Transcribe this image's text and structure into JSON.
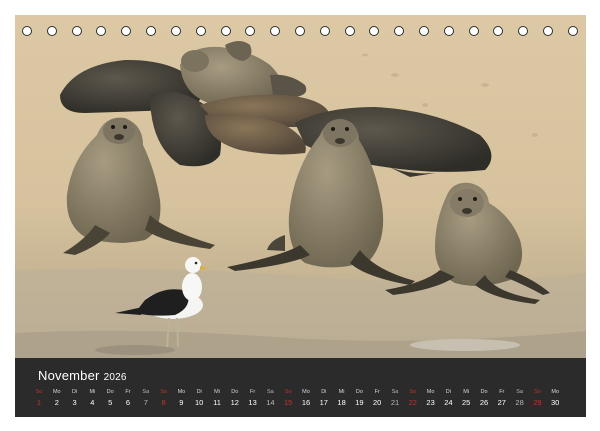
{
  "calendar": {
    "month": "November",
    "year": "2026",
    "days": [
      {
        "wd": "So",
        "d": "1",
        "kind": "sun"
      },
      {
        "wd": "Mo",
        "d": "2",
        "kind": "week"
      },
      {
        "wd": "Di",
        "d": "3",
        "kind": "week"
      },
      {
        "wd": "Mi",
        "d": "4",
        "kind": "week"
      },
      {
        "wd": "Do",
        "d": "5",
        "kind": "week"
      },
      {
        "wd": "Fr",
        "d": "6",
        "kind": "week"
      },
      {
        "wd": "Sa",
        "d": "7",
        "kind": "sat"
      },
      {
        "wd": "So",
        "d": "8",
        "kind": "sun"
      },
      {
        "wd": "Mo",
        "d": "9",
        "kind": "week"
      },
      {
        "wd": "Di",
        "d": "10",
        "kind": "week"
      },
      {
        "wd": "Mi",
        "d": "11",
        "kind": "week"
      },
      {
        "wd": "Do",
        "d": "12",
        "kind": "week"
      },
      {
        "wd": "Fr",
        "d": "13",
        "kind": "week"
      },
      {
        "wd": "Sa",
        "d": "14",
        "kind": "sat"
      },
      {
        "wd": "So",
        "d": "15",
        "kind": "sun"
      },
      {
        "wd": "Mo",
        "d": "16",
        "kind": "week"
      },
      {
        "wd": "Di",
        "d": "17",
        "kind": "week"
      },
      {
        "wd": "Mi",
        "d": "18",
        "kind": "week"
      },
      {
        "wd": "Do",
        "d": "19",
        "kind": "week"
      },
      {
        "wd": "Fr",
        "d": "20",
        "kind": "week"
      },
      {
        "wd": "Sa",
        "d": "21",
        "kind": "sat"
      },
      {
        "wd": "So",
        "d": "22",
        "kind": "sun"
      },
      {
        "wd": "Mo",
        "d": "23",
        "kind": "week"
      },
      {
        "wd": "Di",
        "d": "24",
        "kind": "week"
      },
      {
        "wd": "Mi",
        "d": "25",
        "kind": "week"
      },
      {
        "wd": "Do",
        "d": "26",
        "kind": "week"
      },
      {
        "wd": "Fr",
        "d": "27",
        "kind": "week"
      },
      {
        "wd": "Sa",
        "d": "28",
        "kind": "sat"
      },
      {
        "wd": "So",
        "d": "29",
        "kind": "sun"
      },
      {
        "wd": "Mo",
        "d": "30",
        "kind": "week"
      }
    ]
  },
  "binding": {
    "hole_count": 23
  },
  "colors": {
    "sand": "#d8c49f",
    "wet_sand": "#bfae8e",
    "bar": "#2b2b2b",
    "sunday": "#c0342b"
  }
}
